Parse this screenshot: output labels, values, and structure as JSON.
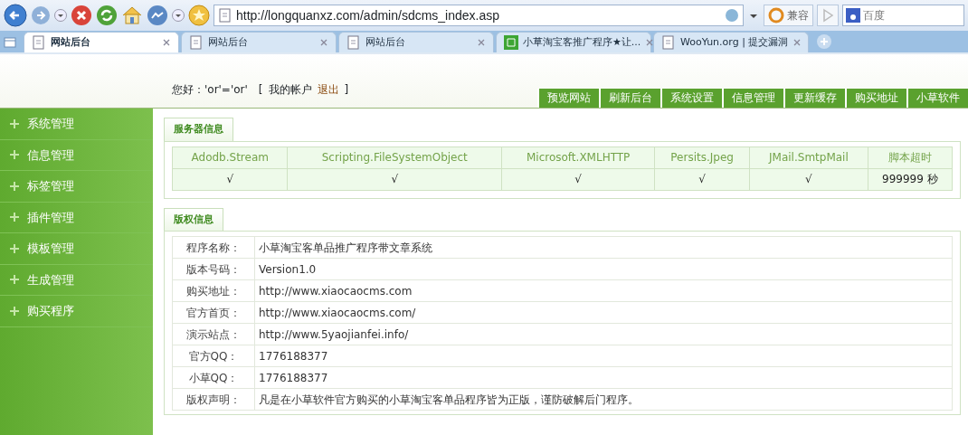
{
  "browser": {
    "address": "http://longquanxz.com/admin/sdcms_index.asp",
    "compat_label": "兼容",
    "search_placeholder": "百度",
    "tabs": [
      {
        "title": "网站后台",
        "kind": "page",
        "selected": true
      },
      {
        "title": "网站后台",
        "kind": "page",
        "selected": false
      },
      {
        "title": "网站后台",
        "kind": "page",
        "selected": false
      },
      {
        "title": "小草淘宝客推广程序★让...",
        "kind": "site",
        "selected": false
      },
      {
        "title": "WooYun.org | 提交漏洞",
        "kind": "page",
        "selected": false
      }
    ]
  },
  "header": {
    "greeting": "您好：'or'='or'",
    "bracket_open": "[",
    "account_link": "我的帐户",
    "logout_link": "退出",
    "bracket_close": "]",
    "nav": [
      "预览网站",
      "刷新后台",
      "系统设置",
      "信息管理",
      "更新缓存",
      "购买地址",
      "小草软件"
    ]
  },
  "sidebar": {
    "items": [
      "系统管理",
      "信息管理",
      "标签管理",
      "插件管理",
      "模板管理",
      "生成管理",
      "购买程序"
    ]
  },
  "server_info": {
    "title": "服务器信息",
    "columns": [
      "Adodb.Stream",
      "Scripting.FileSystemObject",
      "Microsoft.XMLHTTP",
      "Persits.Jpeg",
      "JMail.SmtpMail",
      "脚本超时"
    ],
    "values": [
      "√",
      "√",
      "√",
      "√",
      "√",
      "999999 秒"
    ]
  },
  "copyright": {
    "title": "版权信息",
    "rows": [
      {
        "label": "程序名称：",
        "value": "小草淘宝客单品推广程序带文章系统"
      },
      {
        "label": "版本号码：",
        "value": "Version1.0"
      },
      {
        "label": "购买地址：",
        "value": "http://www.xiaocaocms.com"
      },
      {
        "label": "官方首页：",
        "value": "http://www.xiaocaocms.com/"
      },
      {
        "label": "演示站点：",
        "value": "http://www.5yaojianfei.info/"
      },
      {
        "label": "官方QQ：",
        "value": "1776188377"
      },
      {
        "label": "小草QQ：",
        "value": "1776188377"
      },
      {
        "label": "版权声明：",
        "value": "凡是在小草软件官方购买的小草淘宝客单品程序皆为正版，谨防破解后门程序。"
      }
    ]
  }
}
